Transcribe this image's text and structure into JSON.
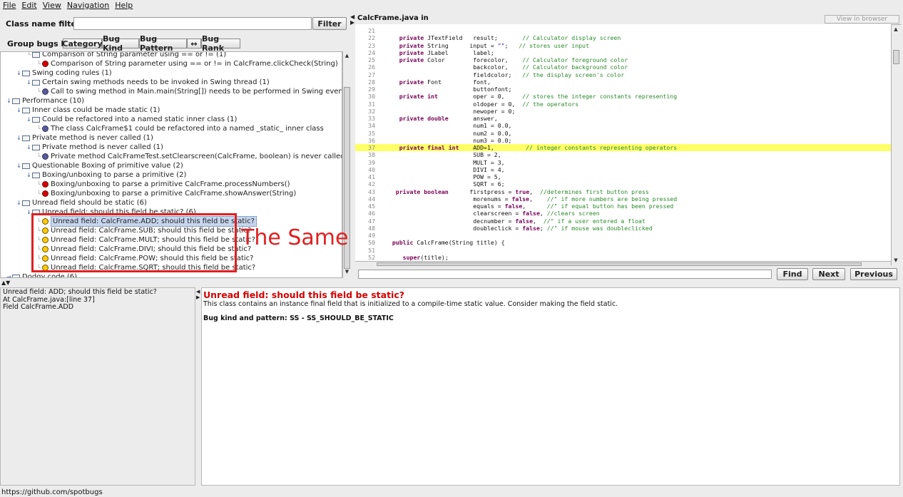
{
  "menu": [
    {
      "label": "File"
    },
    {
      "label": "Edit"
    },
    {
      "label": "View"
    },
    {
      "label": "Navigation"
    },
    {
      "label": "Help"
    }
  ],
  "filter": {
    "label": "Class name filter:",
    "value": "",
    "button": "Filter"
  },
  "group_bugs": {
    "label": "Group bugs by:",
    "buttons": [
      "Category",
      "Bug Kind",
      "Bug Pattern",
      "↔",
      "Bug Rank"
    ]
  },
  "tree": [
    {
      "level": 2,
      "toggle": "",
      "icon": "folder",
      "text": "Comparison of String parameter using == or != (1)"
    },
    {
      "level": 3,
      "toggle": "",
      "icon": "red",
      "text": "Comparison of String parameter using == or != in CalcFrame.clickCheck(String)"
    },
    {
      "level": 1,
      "toggle": "open",
      "icon": "folder",
      "text": "Swing coding rules (1)"
    },
    {
      "level": 2,
      "toggle": "open",
      "icon": "folder",
      "text": "Certain swing methods needs to be invoked in Swing thread (1)"
    },
    {
      "level": 3,
      "toggle": "",
      "icon": "blue",
      "text": "Call to swing method in Main.main(String[]) needs to be performed in Swing event thread"
    },
    {
      "level": 0,
      "toggle": "open",
      "icon": "folder",
      "text": "Performance (10)"
    },
    {
      "level": 1,
      "toggle": "open",
      "icon": "folder",
      "text": "Inner class could be made static (1)"
    },
    {
      "level": 2,
      "toggle": "open",
      "icon": "folder",
      "text": "Could be refactored into a named static inner class (1)"
    },
    {
      "level": 3,
      "toggle": "",
      "icon": "blue",
      "text": "The class CalcFrame$1 could be refactored into a named _static_ inner class"
    },
    {
      "level": 1,
      "toggle": "open",
      "icon": "folder",
      "text": "Private method is never called (1)"
    },
    {
      "level": 2,
      "toggle": "open",
      "icon": "folder",
      "text": "Private method is never called (1)"
    },
    {
      "level": 3,
      "toggle": "",
      "icon": "blue",
      "text": "Private method CalcFrameTest.setClearscreen(CalcFrame, boolean) is never called"
    },
    {
      "level": 1,
      "toggle": "open",
      "icon": "folder",
      "text": "Questionable Boxing of primitive value (2)"
    },
    {
      "level": 2,
      "toggle": "open",
      "icon": "folder",
      "text": "Boxing/unboxing to parse a primitive (2)"
    },
    {
      "level": 3,
      "toggle": "",
      "icon": "red",
      "text": "Boxing/unboxing to parse a primitive CalcFrame.processNumbers()"
    },
    {
      "level": 3,
      "toggle": "",
      "icon": "red",
      "text": "Boxing/unboxing to parse a primitive CalcFrame.showAnswer(String)"
    },
    {
      "level": 1,
      "toggle": "open",
      "icon": "folder",
      "text": "Unread field should be static (6)"
    },
    {
      "level": 2,
      "toggle": "open",
      "icon": "folder",
      "text": "Unread field: should this field be static? (6)"
    },
    {
      "level": 3,
      "toggle": "",
      "icon": "yellow",
      "text": "Unread field: CalcFrame.ADD; should this field be static?",
      "selected": true
    },
    {
      "level": 3,
      "toggle": "",
      "icon": "yellow",
      "text": "Unread field: CalcFrame.SUB; should this field be static?"
    },
    {
      "level": 3,
      "toggle": "",
      "icon": "yellow",
      "text": "Unread field: CalcFrame.MULT; should this field be static?"
    },
    {
      "level": 3,
      "toggle": "",
      "icon": "yellow",
      "text": "Unread field: CalcFrame.DIVI; should this field be static?"
    },
    {
      "level": 3,
      "toggle": "",
      "icon": "yellow",
      "text": "Unread field: CalcFrame.POW; should this field be static?"
    },
    {
      "level": 3,
      "toggle": "",
      "icon": "yellow",
      "text": "Unread field: CalcFrame.SQRT; should this field be static?"
    },
    {
      "level": 0,
      "toggle": "closed",
      "icon": "folder",
      "text": "Dodgy code (6)"
    }
  ],
  "annotation": {
    "text": "The Same",
    "color": "#e02020"
  },
  "code": {
    "title": "CalcFrame.java in",
    "view_in_browser": "View in browser",
    "highlight_line": "37",
    "lines": [
      {
        "n": "21",
        "segs": []
      },
      {
        "n": "22",
        "segs": [
          {
            "t": "    "
          },
          {
            "k": "kw",
            "t": "private"
          },
          {
            "t": " JTextField   result;       "
          },
          {
            "k": "cm",
            "t": "// Calculator display screen"
          }
        ]
      },
      {
        "n": "23",
        "segs": [
          {
            "t": "    "
          },
          {
            "k": "kw",
            "t": "private"
          },
          {
            "t": " String      input = "
          },
          {
            "k": "st",
            "t": "\"\""
          },
          {
            "t": ";   "
          },
          {
            "k": "cm",
            "t": "// stores user input"
          }
        ]
      },
      {
        "n": "24",
        "segs": [
          {
            "t": "    "
          },
          {
            "k": "kw",
            "t": "private"
          },
          {
            "t": " JLabel       label;"
          }
        ]
      },
      {
        "n": "25",
        "segs": [
          {
            "t": "    "
          },
          {
            "k": "kw",
            "t": "private"
          },
          {
            "t": " Color        forecolor,    "
          },
          {
            "k": "cm",
            "t": "// Calculator foreground color"
          }
        ]
      },
      {
        "n": "26",
        "segs": [
          {
            "t": "                         backcolor,    "
          },
          {
            "k": "cm",
            "t": "// Calculator background color"
          }
        ]
      },
      {
        "n": "27",
        "segs": [
          {
            "t": "                         fieldcolor;   "
          },
          {
            "k": "cm",
            "t": "// the display screen's color"
          }
        ]
      },
      {
        "n": "28",
        "segs": [
          {
            "t": "    "
          },
          {
            "k": "kw",
            "t": "private"
          },
          {
            "t": " Font         font,"
          }
        ]
      },
      {
        "n": "29",
        "segs": [
          {
            "t": "                         buttonfont;"
          }
        ]
      },
      {
        "n": "30",
        "segs": [
          {
            "t": "    "
          },
          {
            "k": "kw",
            "t": "private int"
          },
          {
            "t": "          oper = 0,     "
          },
          {
            "k": "cm",
            "t": "// stores the integer constants representing"
          }
        ]
      },
      {
        "n": "31",
        "segs": [
          {
            "t": "                         oldoper = 0,  "
          },
          {
            "k": "cm",
            "t": "// the operators"
          }
        ]
      },
      {
        "n": "32",
        "segs": [
          {
            "t": "                         newoper = 0;"
          }
        ]
      },
      {
        "n": "33",
        "segs": [
          {
            "t": "    "
          },
          {
            "k": "kw",
            "t": "private double"
          },
          {
            "t": "       answer,"
          }
        ]
      },
      {
        "n": "34",
        "segs": [
          {
            "t": "                         num1 = 0.0,"
          }
        ]
      },
      {
        "n": "35",
        "segs": [
          {
            "t": "                         num2 = 0.0,"
          }
        ]
      },
      {
        "n": "36",
        "segs": [
          {
            "t": "                         num3 = 0.0;"
          }
        ]
      },
      {
        "n": "37",
        "segs": [
          {
            "t": "    "
          },
          {
            "k": "kw",
            "t": "private final int"
          },
          {
            "t": "    ADD=1,         "
          },
          {
            "k": "cm",
            "t": "// integer constants representing operators"
          }
        ]
      },
      {
        "n": "38",
        "segs": [
          {
            "t": "                         SUB = 2,"
          }
        ]
      },
      {
        "n": "39",
        "segs": [
          {
            "t": "                         MULT = 3,"
          }
        ]
      },
      {
        "n": "40",
        "segs": [
          {
            "t": "                         DIVI = 4,"
          }
        ]
      },
      {
        "n": "41",
        "segs": [
          {
            "t": "                         POW = 5,"
          }
        ]
      },
      {
        "n": "42",
        "segs": [
          {
            "t": "                         SQRT = 6;"
          }
        ]
      },
      {
        "n": "43",
        "segs": [
          {
            "t": "   "
          },
          {
            "k": "kw",
            "t": "private boolean"
          },
          {
            "t": "      firstpress = "
          },
          {
            "k": "kw",
            "t": "true"
          },
          {
            "t": ",  "
          },
          {
            "k": "cm",
            "t": "//determines first button press"
          }
        ]
      },
      {
        "n": "44",
        "segs": [
          {
            "t": "                         morenums = "
          },
          {
            "k": "kw",
            "t": "false"
          },
          {
            "t": ",    "
          },
          {
            "k": "cm",
            "t": "//\" if more numbers are being pressed"
          }
        ]
      },
      {
        "n": "45",
        "segs": [
          {
            "t": "                         equals = "
          },
          {
            "k": "kw",
            "t": "false"
          },
          {
            "t": ",      "
          },
          {
            "k": "cm",
            "t": "//\" if equal button has been pressed"
          }
        ]
      },
      {
        "n": "46",
        "segs": [
          {
            "t": "                         clearscreen = "
          },
          {
            "k": "kw",
            "t": "false"
          },
          {
            "t": ", "
          },
          {
            "k": "cm",
            "t": "//clears screen"
          }
        ]
      },
      {
        "n": "47",
        "segs": [
          {
            "t": "                         decnumber = "
          },
          {
            "k": "kw",
            "t": "false"
          },
          {
            "t": ",  "
          },
          {
            "k": "cm",
            "t": "//\" if a user entered a float"
          }
        ]
      },
      {
        "n": "48",
        "segs": [
          {
            "t": "                         doubleclick = "
          },
          {
            "k": "kw",
            "t": "false"
          },
          {
            "t": "; "
          },
          {
            "k": "cm",
            "t": "//\" if mouse was doubleclicked"
          }
        ]
      },
      {
        "n": "49",
        "segs": []
      },
      {
        "n": "50",
        "segs": [
          {
            "t": "  "
          },
          {
            "k": "kw",
            "t": "public"
          },
          {
            "t": " CalcFrame(String title) {"
          }
        ]
      },
      {
        "n": "51",
        "segs": []
      },
      {
        "n": "52",
        "segs": [
          {
            "t": "     "
          },
          {
            "k": "kw",
            "t": "super"
          },
          {
            "t": "(title);"
          }
        ]
      }
    ]
  },
  "find": {
    "value": "",
    "find": "Find",
    "next": "Next",
    "previous": "Previous"
  },
  "details": {
    "summary_lines": [
      "Unread field: ADD; should this field be static?",
      "At CalcFrame.java:[line 37]",
      "Field CalcFrame.ADD"
    ],
    "title": "Unread field: should this field be static?",
    "description": "This class contains an instance final field that is initialized to a compile-time static value. Consider making the field static.",
    "pattern": "Bug kind and pattern: SS - SS_SHOULD_BE_STATIC"
  },
  "status": "https://github.com/spotbugs"
}
